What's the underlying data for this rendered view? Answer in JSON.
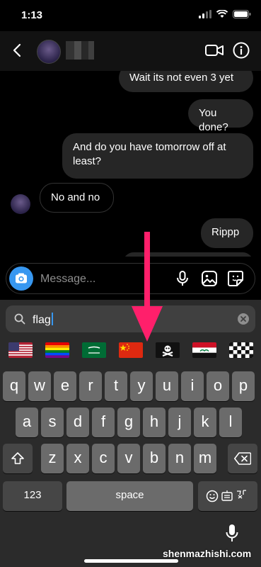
{
  "status_bar": {
    "time": "1:13"
  },
  "messages": [
    {
      "text": "Wait its not even 3 yet",
      "from": "me"
    },
    {
      "text": "You done?",
      "from": "me"
    },
    {
      "text": "And do you have tomorrow off at least?",
      "from": "me"
    },
    {
      "text": "No and no",
      "from": "them"
    },
    {
      "text": "Rippp",
      "from": "me"
    }
  ],
  "composer": {
    "placeholder": "Message..."
  },
  "emoji_search": {
    "query": "flag"
  },
  "flags": [
    "us-flag",
    "rainbow-flag",
    "saudi-arabia-flag",
    "china-flag",
    "pirate-flag",
    "iraq-flag",
    "checkered-flag"
  ],
  "keyboard": {
    "row1": [
      "q",
      "w",
      "e",
      "r",
      "t",
      "y",
      "u",
      "i",
      "o",
      "p"
    ],
    "row2": [
      "a",
      "s",
      "d",
      "f",
      "g",
      "h",
      "j",
      "k",
      "l"
    ],
    "row3": [
      "z",
      "x",
      "c",
      "v",
      "b",
      "n",
      "m"
    ],
    "numbers_label": "123",
    "space_label": "space"
  },
  "colors": {
    "accent": "#3797f0",
    "arrow": "#ff1f6b",
    "bubble": "#262626"
  },
  "watermark": "shenmazhishi.com"
}
